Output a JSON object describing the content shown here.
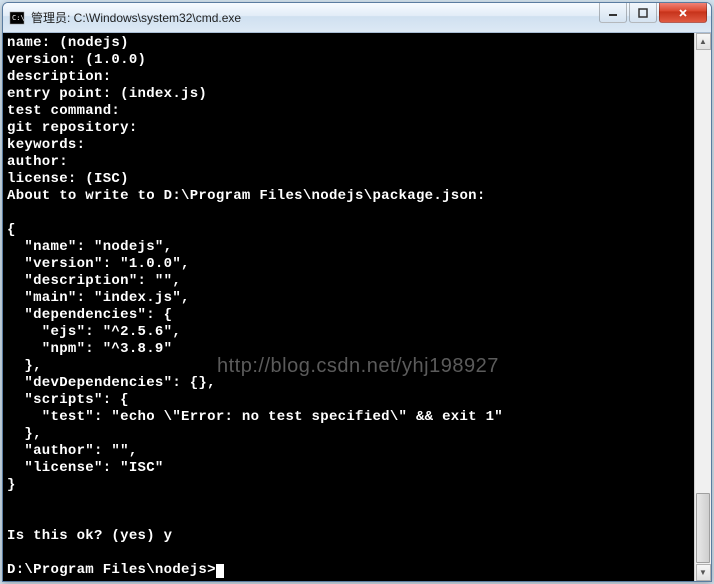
{
  "window": {
    "title": "管理员: C:\\Windows\\system32\\cmd.exe"
  },
  "watermark": "http://blog.csdn.net/yhj198927",
  "console": {
    "lines": [
      "name: (nodejs)",
      "version: (1.0.0)",
      "description:",
      "entry point: (index.js)",
      "test command:",
      "git repository:",
      "keywords:",
      "author:",
      "license: (ISC)",
      "About to write to D:\\Program Files\\nodejs\\package.json:",
      "",
      "{",
      "  \"name\": \"nodejs\",",
      "  \"version\": \"1.0.0\",",
      "  \"description\": \"\",",
      "  \"main\": \"index.js\",",
      "  \"dependencies\": {",
      "    \"ejs\": \"^2.5.6\",",
      "    \"npm\": \"^3.8.9\"",
      "  },",
      "  \"devDependencies\": {},",
      "  \"scripts\": {",
      "    \"test\": \"echo \\\"Error: no test specified\\\" && exit 1\"",
      "  },",
      "  \"author\": \"\",",
      "  \"license\": \"ISC\"",
      "}",
      "",
      "",
      "Is this ok? (yes) y",
      "",
      "D:\\Program Files\\nodejs>"
    ]
  }
}
